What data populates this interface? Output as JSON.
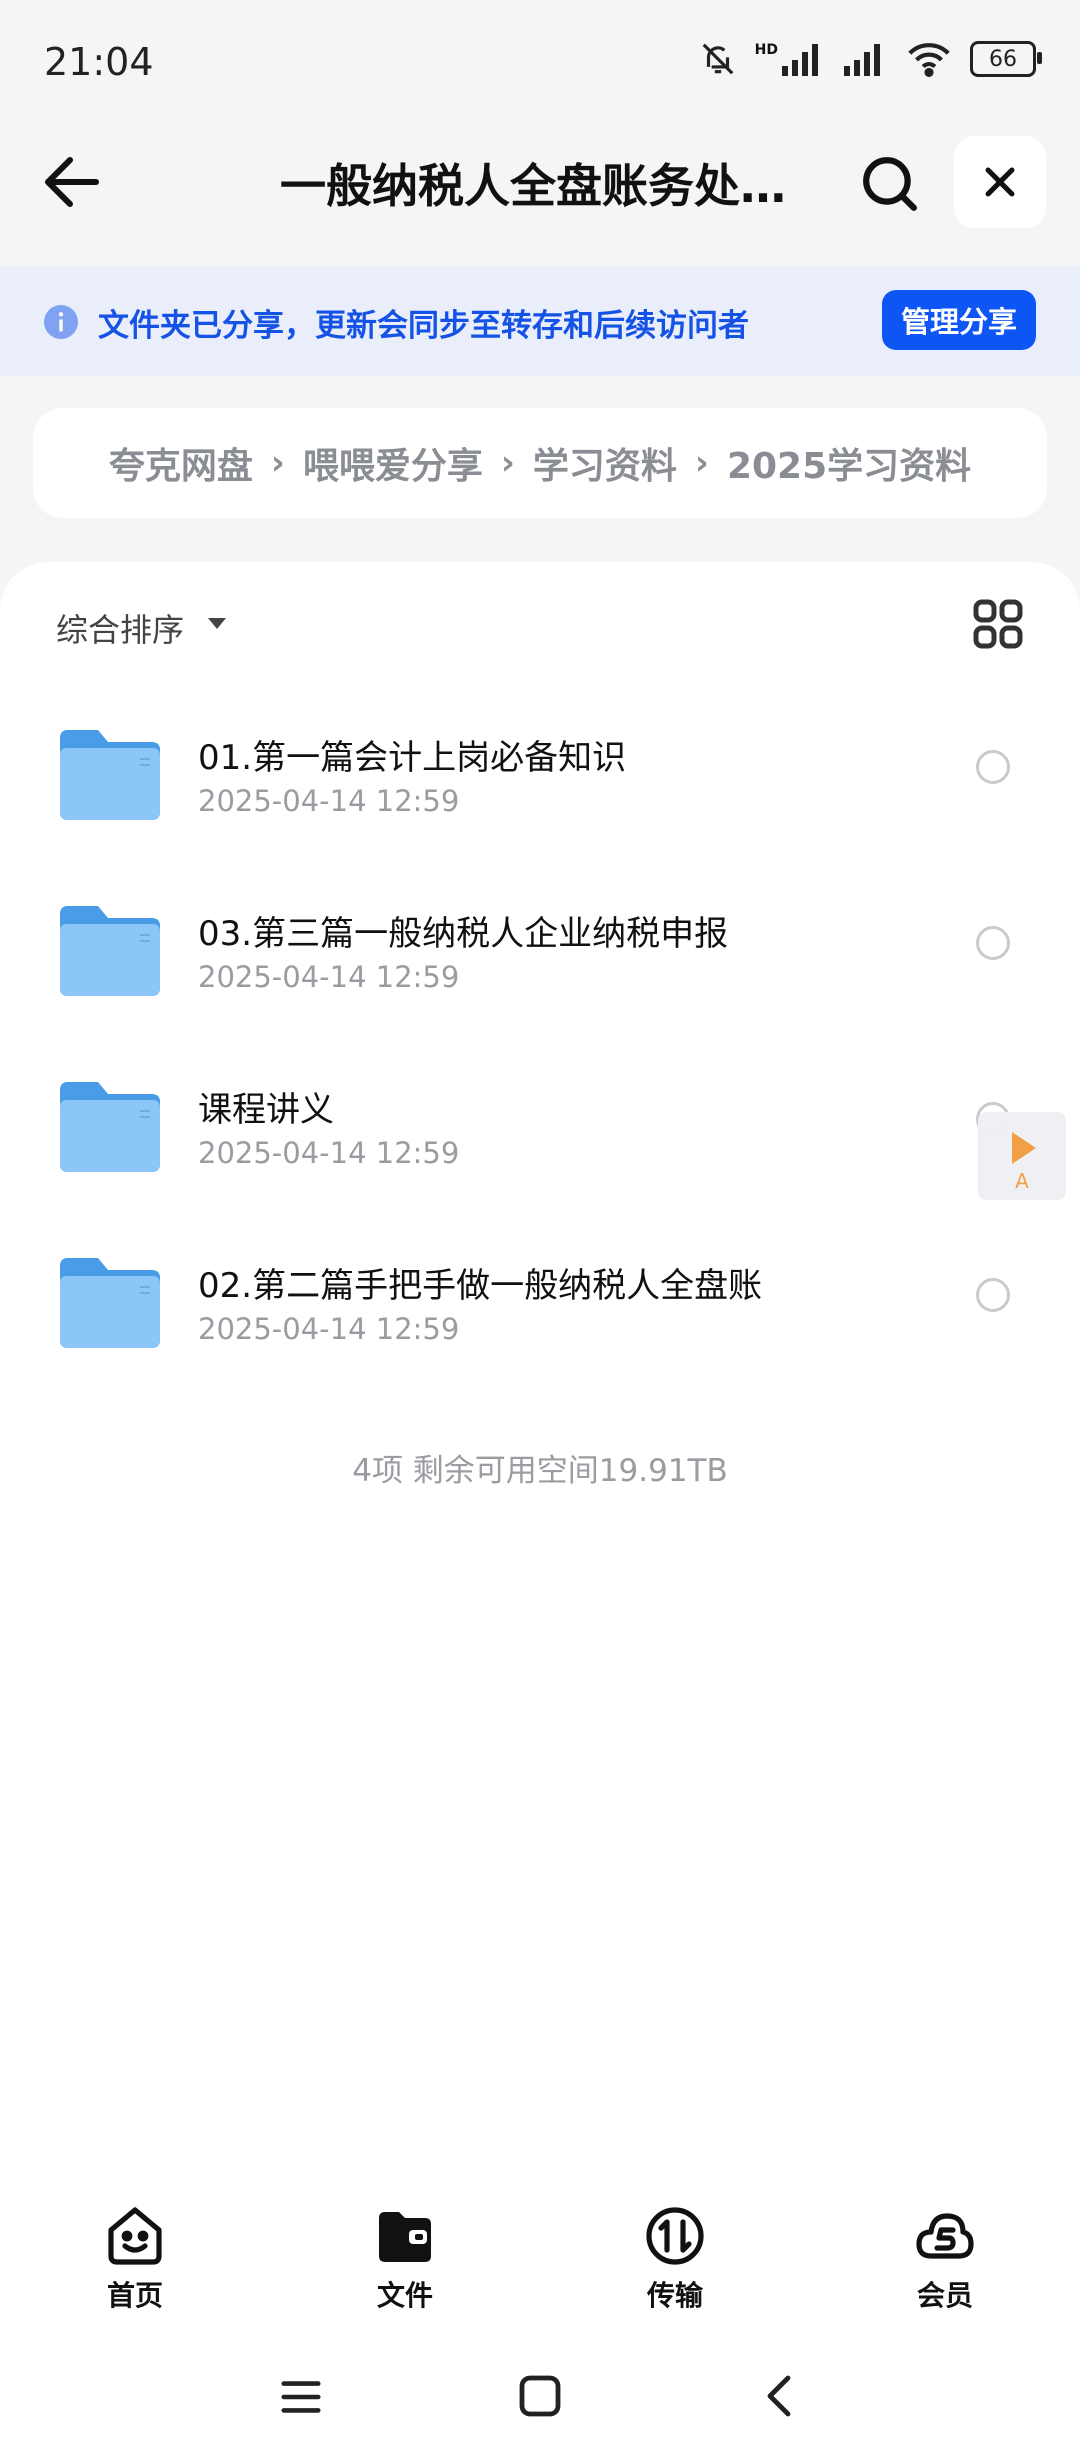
{
  "status_bar": {
    "time": "21:04",
    "battery": "66",
    "network_label": "HD"
  },
  "header": {
    "title": "一般纳税人全盘账务处…"
  },
  "banner": {
    "text": "文件夹已分享，更新会同步至转存和后续访问者",
    "manage_label": "管理分享"
  },
  "breadcrumb": {
    "items": [
      "夸克网盘",
      "喂喂爱分享",
      "学习资料",
      "2025学习资料"
    ]
  },
  "sort": {
    "label": "综合排序"
  },
  "files": [
    {
      "name": "01.第一篇会计上岗必备知识",
      "date": "2025-04-14 12:59"
    },
    {
      "name": "03.第三篇一般纳税人企业纳税申报",
      "date": "2025-04-14 12:59"
    },
    {
      "name": "课程讲义",
      "date": "2025-04-14 12:59"
    },
    {
      "name": "02.第二篇手把手做一般纳税人全盘账",
      "date": "2025-04-14 12:59"
    }
  ],
  "footer_info": "4项 剩余可用空间19.91TB",
  "floating_widget": {
    "label": "A"
  },
  "bottom_nav": [
    {
      "label": "首页",
      "icon": "home-smile-icon"
    },
    {
      "label": "文件",
      "icon": "folder-files-icon"
    },
    {
      "label": "传输",
      "icon": "transfer-icon"
    },
    {
      "label": "会员",
      "icon": "vip-cloud-icon"
    }
  ],
  "colors": {
    "accent": "#0d55f5",
    "banner_bg": "#e9eefa",
    "folder": "#5aa9ee"
  }
}
